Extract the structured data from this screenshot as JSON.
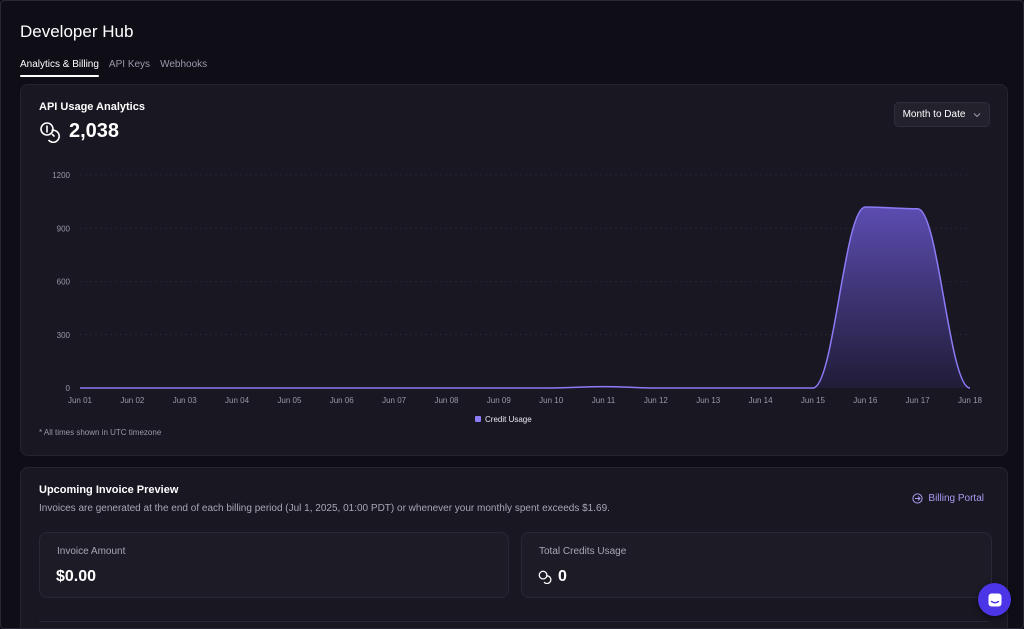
{
  "page": {
    "title": "Developer Hub"
  },
  "tabs": [
    {
      "label": "Analytics & Billing",
      "active": true
    },
    {
      "label": "API Keys",
      "active": false
    },
    {
      "label": "Webhooks",
      "active": false
    }
  ],
  "usage": {
    "title": "API Usage Analytics",
    "total_icon": "coins-icon",
    "total": "2,038",
    "range_select": {
      "value": "Month to Date",
      "icon": "chevron-down-icon"
    },
    "timezone_note": "* All times shown in UTC timezone"
  },
  "chart_data": {
    "type": "area",
    "title": "",
    "xlabel": "",
    "ylabel": "",
    "x": [
      "Jun 01",
      "Jun 02",
      "Jun 03",
      "Jun 04",
      "Jun 05",
      "Jun 06",
      "Jun 07",
      "Jun 08",
      "Jun 09",
      "Jun 10",
      "Jun 11",
      "Jun 12",
      "Jun 13",
      "Jun 14",
      "Jun 15",
      "Jun 16",
      "Jun 17",
      "Jun 18"
    ],
    "series": [
      {
        "name": "Credit Usage",
        "color": "#8b7cf6",
        "values": [
          0,
          0,
          0,
          0,
          0,
          0,
          0,
          0,
          0,
          0,
          8,
          0,
          0,
          0,
          0,
          1020,
          1010,
          0
        ]
      }
    ],
    "ylim": [
      0,
      1200
    ],
    "yticks": [
      0,
      300,
      600,
      900,
      1200
    ],
    "grid": true,
    "legend_position": "bottom-center"
  },
  "invoice": {
    "title": "Upcoming Invoice Preview",
    "description": "Invoices are generated at the end of each billing period (Jul 1, 2025, 01:00 PDT) or whenever your monthly spent exceeds $1.69.",
    "portal_link": "Billing Portal",
    "portal_icon": "arrow-circle-right-icon",
    "invoice_amount_label": "Invoice Amount",
    "invoice_amount": "$0.00",
    "credits_label": "Total Credits Usage",
    "credits_value": "0"
  },
  "chat": {
    "icon": "chat-icon"
  },
  "colors": {
    "accent": "#8b7cf6",
    "chat_button": "#4b35e6",
    "link": "#a99bf0"
  }
}
